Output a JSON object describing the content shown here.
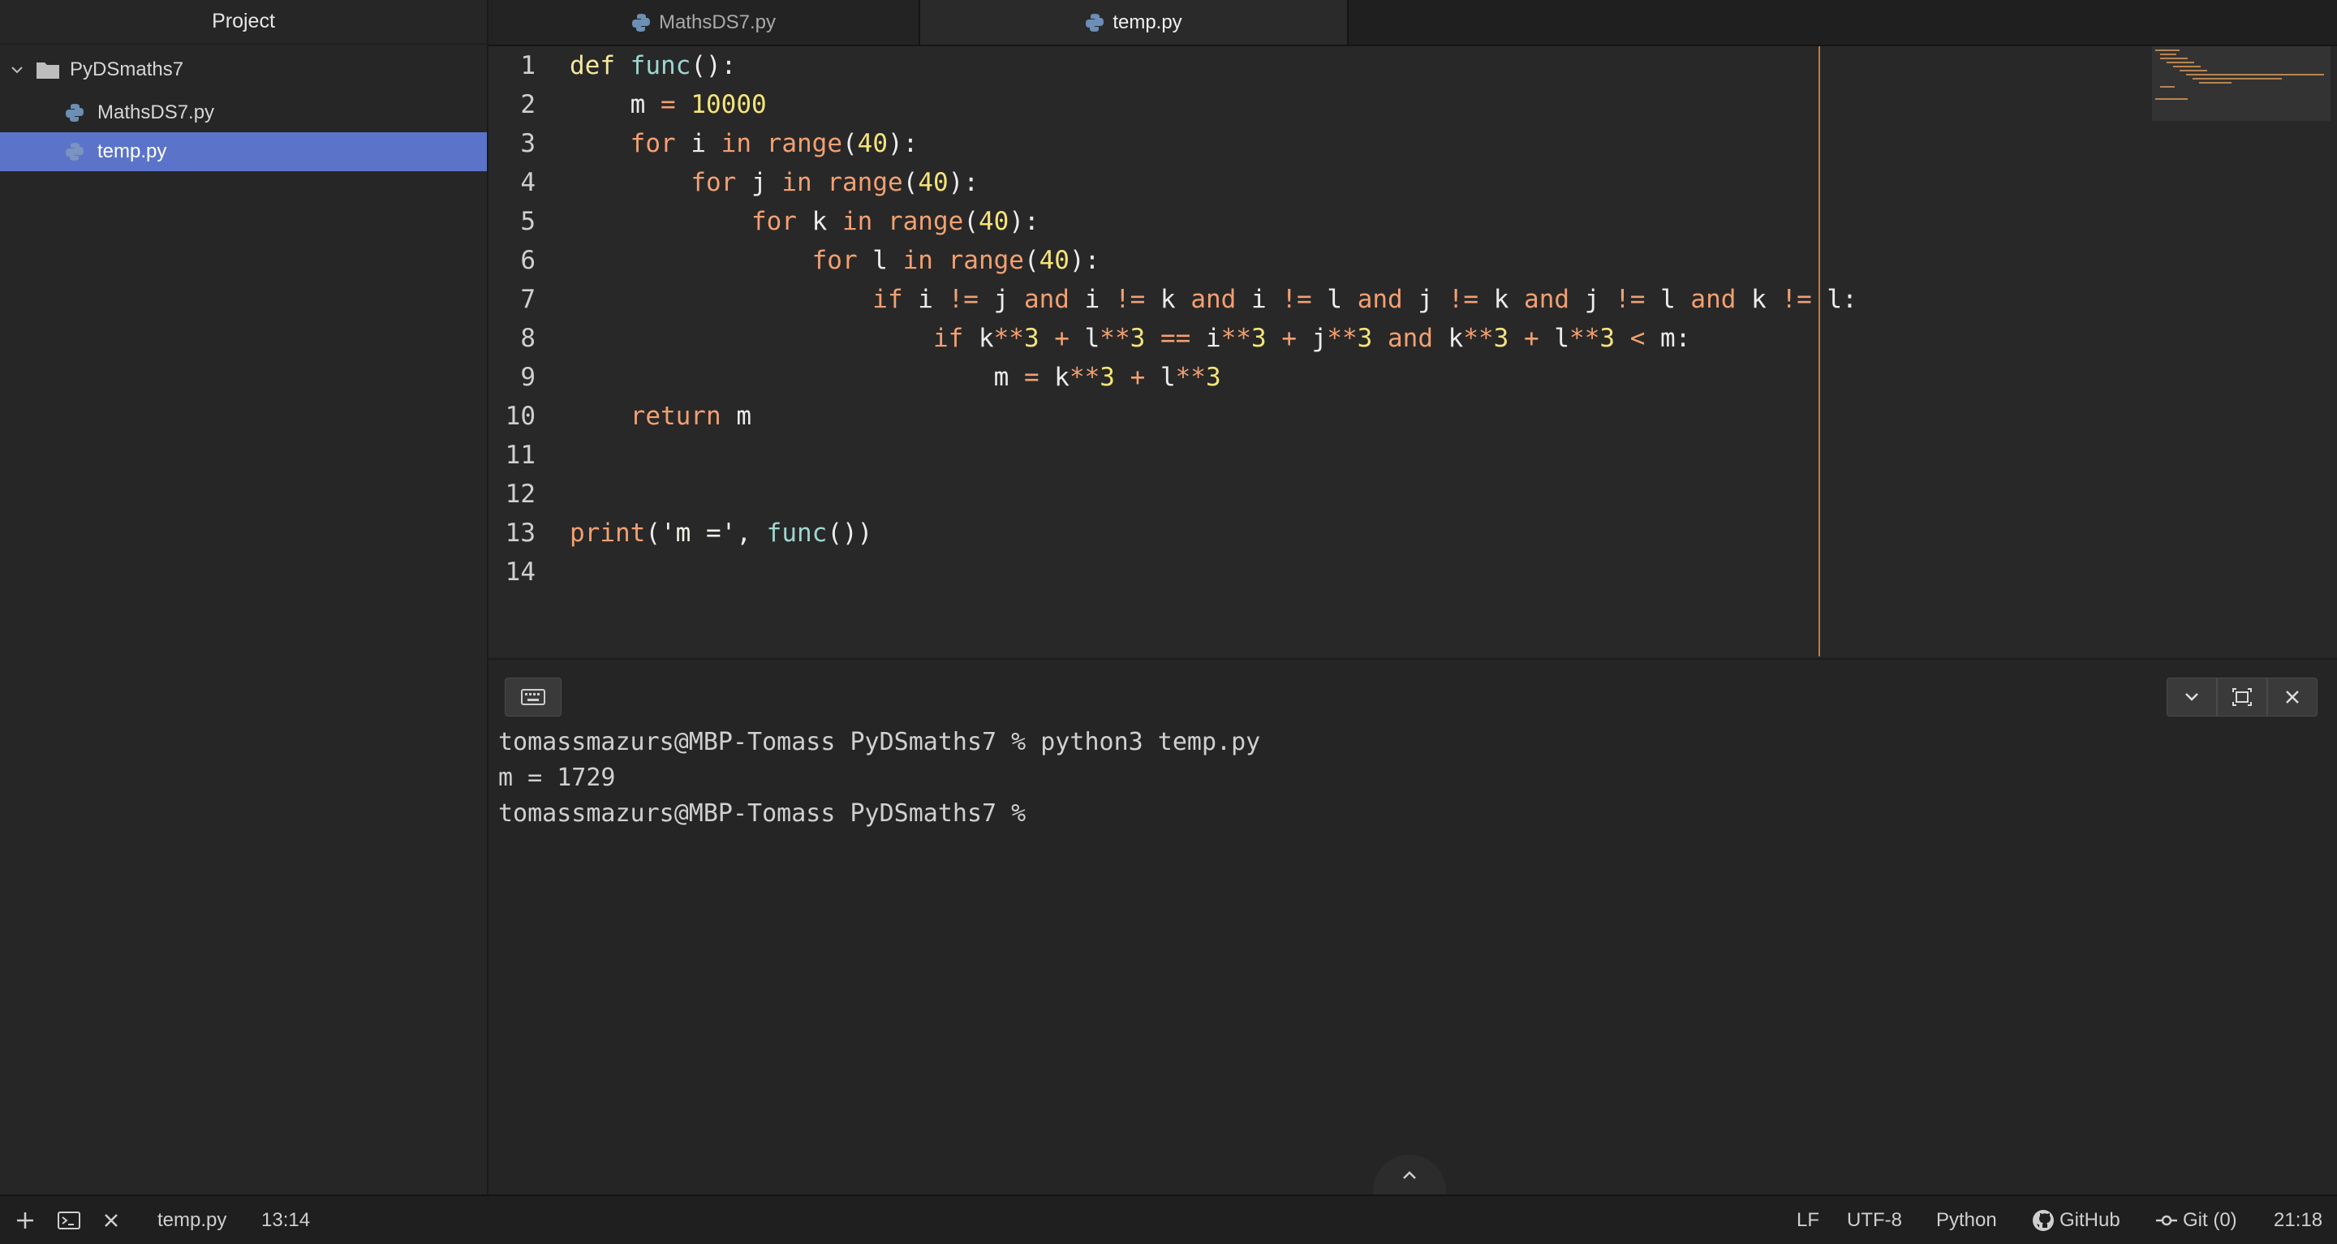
{
  "sidebar": {
    "title": "Project",
    "project": "PyDSmaths7",
    "files": [
      "MathsDS7.py",
      "temp.py"
    ],
    "selected_index": 1
  },
  "tabs": [
    {
      "label": "MathsDS7.py",
      "active": false
    },
    {
      "label": "temp.py",
      "active": true
    }
  ],
  "editor": {
    "line_numbers": [
      "1",
      "2",
      "3",
      "4",
      "5",
      "6",
      "7",
      "8",
      "9",
      "10",
      "11",
      "12",
      "13",
      "14"
    ]
  },
  "terminal": {
    "lines": [
      "tomassmazurs@MBP-Tomass PyDSmaths7 % python3 temp.py",
      "m = 1729",
      "tomassmazurs@MBP-Tomass PyDSmaths7 %"
    ]
  },
  "statusbar": {
    "file": "temp.py",
    "cursor": "13:14",
    "line_ending": "LF",
    "encoding": "UTF-8",
    "language": "Python",
    "github": "GitHub",
    "git": "Git (0)",
    "clock": "21:18"
  },
  "colors": {
    "selection": "#5b74c9",
    "keyword": "#f2a072",
    "function": "#9dd6cf",
    "number": "#f4e47a",
    "ruler": "#c87a3a"
  }
}
